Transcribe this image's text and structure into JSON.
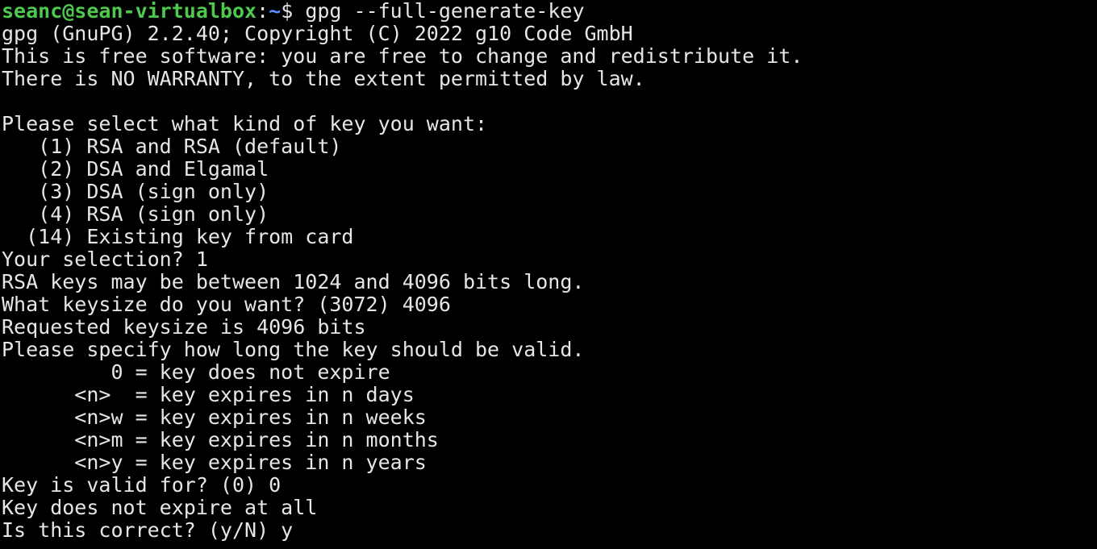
{
  "prompt": {
    "user_host": "seanc@sean-virtualbox",
    "separator": ":",
    "path": "~",
    "symbol": "$ ",
    "command": "gpg --full-generate-key"
  },
  "output_lines": [
    "gpg (GnuPG) 2.2.40; Copyright (C) 2022 g10 Code GmbH",
    "This is free software: you are free to change and redistribute it.",
    "There is NO WARRANTY, to the extent permitted by law.",
    "",
    "Please select what kind of key you want:",
    "   (1) RSA and RSA (default)",
    "   (2) DSA and Elgamal",
    "   (3) DSA (sign only)",
    "   (4) RSA (sign only)",
    "  (14) Existing key from card",
    "Your selection? 1",
    "RSA keys may be between 1024 and 4096 bits long.",
    "What keysize do you want? (3072) 4096",
    "Requested keysize is 4096 bits",
    "Please specify how long the key should be valid.",
    "         0 = key does not expire",
    "      <n>  = key expires in n days",
    "      <n>w = key expires in n weeks",
    "      <n>m = key expires in n months",
    "      <n>y = key expires in n years",
    "Key is valid for? (0) 0",
    "Key does not expire at all",
    "Is this correct? (y/N) y"
  ],
  "colors": {
    "background": "#000000",
    "foreground": "#e6e6e6",
    "prompt_user": "#4ec94e",
    "prompt_path": "#5b8cff"
  }
}
